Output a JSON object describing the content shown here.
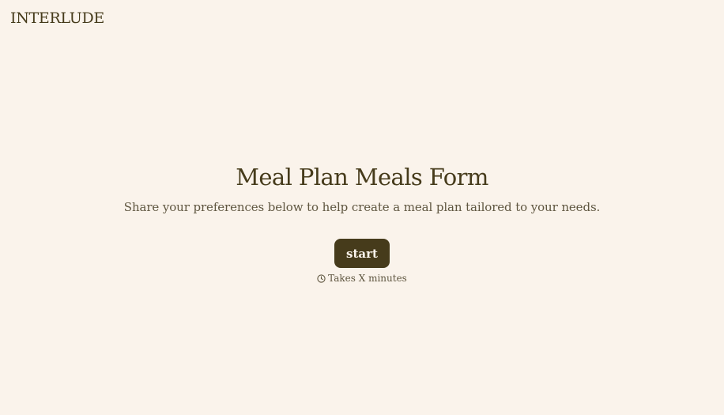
{
  "brand": {
    "name": "INTERLUDE"
  },
  "form": {
    "title": "Meal Plan Meals Form",
    "subtitle": "Share your preferences below to help create a meal plan tailored to your needs.",
    "start_label": "start",
    "duration_text": "Takes X minutes",
    "duration_icon": "clock-icon"
  },
  "colors": {
    "background": "#faf3eb",
    "primary": "#463b1b",
    "muted_text": "#5f5640"
  }
}
